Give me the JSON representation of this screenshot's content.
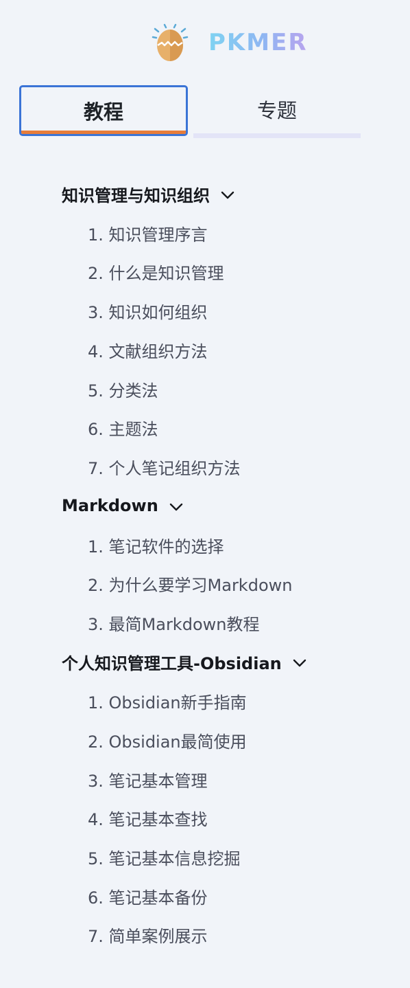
{
  "logo": {
    "text": "PKMER"
  },
  "tabs": [
    {
      "label": "教程",
      "active": true
    },
    {
      "label": "专题",
      "active": false
    }
  ],
  "accent_colors": {
    "tab_border": "#3b74d6",
    "tab_underline": "#e77c3a",
    "inactive_bar": "#e3e4f7"
  },
  "sections": [
    {
      "title": "知识管理与知识组织",
      "expanded": true,
      "items": [
        "1. 知识管理序言",
        "2. 什么是知识管理",
        "3. 知识如何组织",
        "4. 文献组织方法",
        "5. 分类法",
        "6. 主题法",
        "7. 个人笔记组织方法"
      ]
    },
    {
      "title": "Markdown",
      "expanded": true,
      "items": [
        "1. 笔记软件的选择",
        "2. 为什么要学习Markdown",
        "3. 最简Markdown教程"
      ]
    },
    {
      "title": "个人知识管理工具-Obsidian",
      "expanded": true,
      "items": [
        "1. Obsidian新手指南",
        "2. Obsidian最简使用",
        "3. 笔记基本管理",
        "4. 笔记基本查找",
        "5. 笔记基本信息挖掘",
        "6. 笔记基本备份",
        "7. 简单案例展示"
      ]
    }
  ]
}
